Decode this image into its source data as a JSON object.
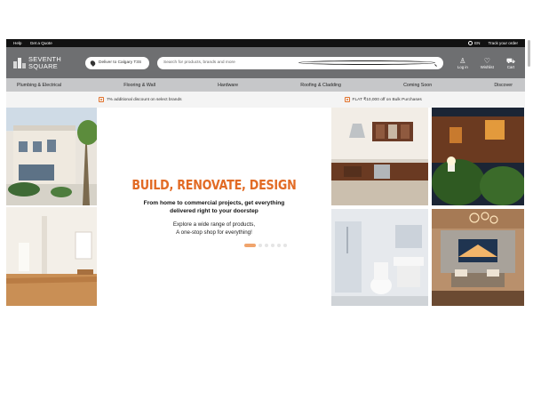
{
  "topbar": {
    "help": "Help",
    "quote": "Get a Quote",
    "language": "EN",
    "track": "Track your order"
  },
  "header": {
    "logo_line1": "SEVENTH",
    "logo_line2": "SQUARE",
    "deliver_label": "Deliver to Calgary T3S",
    "search_placeholder": "Search for products, brands and more",
    "login": "Log in",
    "wishlist": "Wishlist",
    "cart": "Cart"
  },
  "nav": {
    "items": [
      "Plumbing & Electrical",
      "Flooring & Wall",
      "Hardware",
      "Roofing & Cladding",
      "Coming Soon",
      "Discover"
    ]
  },
  "promo": {
    "left": "7% additional discount on select brands",
    "right": "FLAT ₹10,000 off on Bulk Purchases"
  },
  "hero": {
    "headline": "BUILD, RENOVATE, DESIGN",
    "sub_line": "From home to commercial projects, get everything delivered right to your doorstep",
    "sub2_line1": "Explore a wide range of products,",
    "sub2_line2": "A one-stop shop for everything!",
    "slide_count": 6,
    "active_slide": 1
  },
  "colors": {
    "accent": "#e26b25",
    "header_bg": "#6e6f71",
    "nav_bg": "#c6c7c9",
    "topbar_bg": "#111111"
  }
}
